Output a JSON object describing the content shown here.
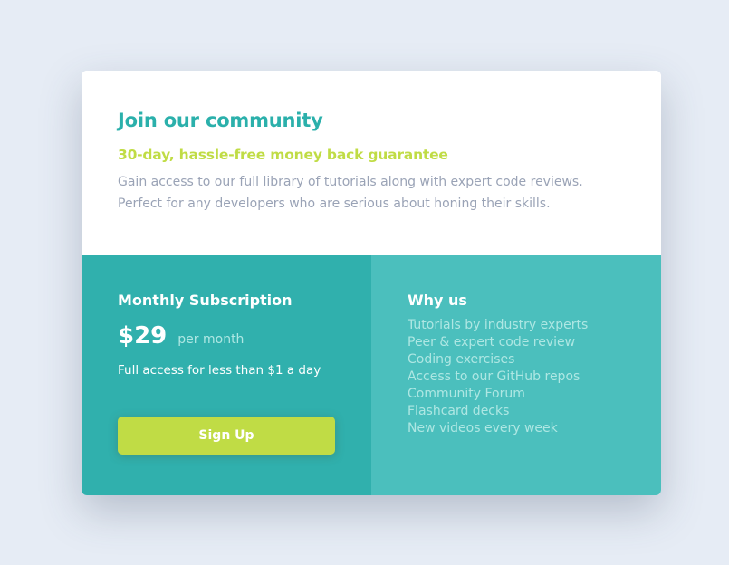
{
  "colors": {
    "title": "#2bb0ab",
    "accent": "#c0dc45",
    "description": "#9aa3b6",
    "subscription_bg": "#30b0ad",
    "why_bg": "#4bbfbd",
    "light_text": "#aee7e3"
  },
  "header": {
    "title": "Join our community",
    "subtitle": "30-day, hassle-free money back guarantee",
    "description": "Gain access to our full library of tutorials along with expert code reviews. Perfect for any developers who are serious about honing their skills."
  },
  "subscription": {
    "heading": "Monthly Subscription",
    "price": "$29",
    "period": "per month",
    "access": "Full access for less than $1 a day",
    "button_label": "Sign Up"
  },
  "why": {
    "heading": "Why us",
    "items": [
      "Tutorials by industry experts",
      "Peer & expert code review",
      "Coding exercises",
      "Access to our GitHub repos",
      "Community Forum",
      "Flashcard decks",
      "New videos every week"
    ]
  }
}
